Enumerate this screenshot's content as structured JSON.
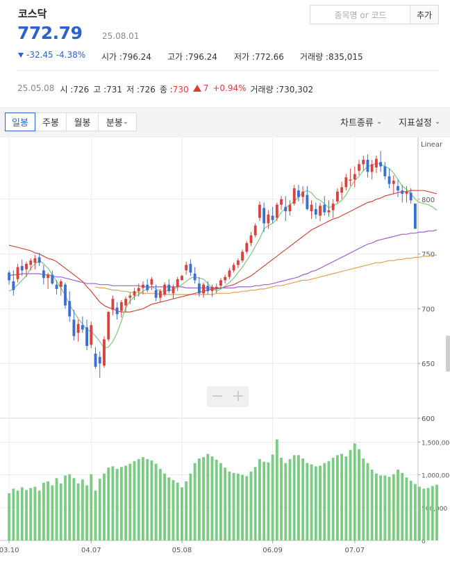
{
  "header": {
    "index_name": "코스닥",
    "search_placeholder": "종목명 or 코드",
    "add_button": "추가"
  },
  "quote": {
    "price": "772.79",
    "date": "25.08.01",
    "change": "-32.45",
    "change_pct": "-4.38%",
    "open_label": "시가 :",
    "open": "796.24",
    "high_label": "고가 :",
    "high": "796.24",
    "low_label": "저가 :",
    "low": "772.66",
    "volume_label": "거래량 :",
    "volume": "835,015"
  },
  "daily_info": {
    "date": "25.05.08",
    "open_label": "시 :",
    "open": "726",
    "high_label": "고 :",
    "high": "731",
    "low_label": "저 :",
    "low": "726",
    "close_label": "종 :",
    "close": "730",
    "change": "7",
    "change_pct": "+0.94%",
    "volume_label": "거래량 :",
    "volume": "730,302"
  },
  "toolbar": {
    "tabs": [
      "일봉",
      "주봉",
      "월봉",
      "분봉"
    ],
    "active_tab": "일봉",
    "chart_type": "차트종류",
    "indicator": "지표설정"
  },
  "colors": {
    "up": "#d9423e",
    "down": "#3b6fd0",
    "ma5": "#7ec87e",
    "ma20": "#c94b3f",
    "ma60": "#9b5fd6",
    "ma120": "#e0a050",
    "volume": "#7ccb84"
  },
  "zoom": {
    "minus": "−",
    "plus": "+"
  },
  "chart_data": {
    "type": "candlestick",
    "scale": "Linear",
    "ylim": [
      600,
      850
    ],
    "y_ticks": [
      "800",
      "750",
      "700",
      "650",
      "600"
    ],
    "volume_ylim": [
      0,
      1800000
    ],
    "volume_ticks": [
      "1,500,000",
      "1,000,000",
      "500,000",
      "0"
    ],
    "x_ticks": [
      "03.10",
      "04.07",
      "05.08",
      "06.09",
      "07.07"
    ],
    "x_tick_index": [
      0,
      19,
      40,
      61,
      80
    ],
    "candles": [
      [
        733,
        735,
        722,
        726
      ],
      [
        725,
        735,
        712,
        717
      ],
      [
        727,
        741,
        724,
        738
      ],
      [
        739,
        745,
        730,
        735
      ],
      [
        736,
        743,
        729,
        741
      ],
      [
        740,
        746,
        735,
        744
      ],
      [
        742,
        749,
        736,
        746
      ],
      [
        747,
        751,
        739,
        742
      ],
      [
        735,
        740,
        722,
        728
      ],
      [
        728,
        733,
        718,
        731
      ],
      [
        731,
        735,
        722,
        723
      ],
      [
        722,
        726,
        713,
        718
      ],
      [
        720,
        727,
        712,
        725
      ],
      [
        722,
        724,
        700,
        703
      ],
      [
        707,
        716,
        688,
        693
      ],
      [
        690,
        699,
        671,
        675
      ],
      [
        678,
        690,
        670,
        686
      ],
      [
        685,
        693,
        678,
        681
      ],
      [
        683,
        690,
        662,
        666
      ],
      [
        667,
        688,
        664,
        685
      ],
      [
        659,
        665,
        645,
        647
      ],
      [
        656,
        661,
        637,
        650
      ],
      [
        648,
        675,
        646,
        672
      ],
      [
        672,
        698,
        670,
        697
      ],
      [
        699,
        712,
        694,
        709
      ],
      [
        701,
        706,
        690,
        695
      ],
      [
        698,
        708,
        692,
        706
      ],
      [
        703,
        711,
        697,
        709
      ],
      [
        710,
        715,
        704,
        712
      ],
      [
        712,
        719,
        708,
        716
      ],
      [
        716,
        723,
        711,
        719
      ],
      [
        719,
        725,
        713,
        722
      ],
      [
        722,
        727,
        715,
        717
      ],
      [
        722,
        729,
        717,
        727
      ],
      [
        717,
        722,
        707,
        710
      ],
      [
        710,
        718,
        706,
        716
      ],
      [
        713,
        724,
        711,
        722
      ],
      [
        722,
        727,
        714,
        716
      ],
      [
        714,
        722,
        709,
        720
      ],
      [
        720,
        729,
        716,
        727
      ],
      [
        726,
        731,
        726,
        730
      ],
      [
        735,
        743,
        731,
        740
      ],
      [
        741,
        745,
        730,
        733
      ],
      [
        732,
        738,
        723,
        726
      ],
      [
        723,
        729,
        711,
        714
      ],
      [
        714,
        724,
        710,
        722
      ],
      [
        721,
        725,
        713,
        716
      ],
      [
        716,
        722,
        711,
        720
      ],
      [
        718,
        723,
        714,
        720
      ],
      [
        721,
        728,
        718,
        726
      ],
      [
        726,
        731,
        723,
        729
      ],
      [
        729,
        737,
        727,
        735
      ],
      [
        735,
        742,
        733,
        740
      ],
      [
        740,
        746,
        737,
        744
      ],
      [
        744,
        754,
        742,
        752
      ],
      [
        752,
        762,
        750,
        760
      ],
      [
        760,
        770,
        757,
        767
      ],
      [
        767,
        778,
        765,
        776
      ],
      [
        783,
        798,
        780,
        795
      ],
      [
        792,
        797,
        770,
        778
      ],
      [
        778,
        790,
        773,
        786
      ],
      [
        785,
        793,
        778,
        781
      ],
      [
        783,
        797,
        780,
        795
      ],
      [
        795,
        803,
        790,
        800
      ],
      [
        793,
        803,
        780,
        789
      ],
      [
        789,
        799,
        785,
        795
      ],
      [
        796,
        813,
        794,
        810
      ],
      [
        808,
        813,
        798,
        802
      ],
      [
        802,
        812,
        796,
        807
      ],
      [
        804,
        812,
        790,
        791
      ],
      [
        789,
        799,
        782,
        795
      ],
      [
        791,
        797,
        782,
        786
      ],
      [
        785,
        797,
        780,
        794
      ],
      [
        795,
        803,
        785,
        788
      ],
      [
        788,
        799,
        784,
        790
      ],
      [
        790,
        800,
        783,
        796
      ],
      [
        798,
        810,
        796,
        807
      ],
      [
        806,
        816,
        800,
        811
      ],
      [
        811,
        823,
        808,
        820
      ],
      [
        817,
        828,
        812,
        818
      ],
      [
        818,
        830,
        811,
        823
      ],
      [
        826,
        836,
        822,
        832
      ],
      [
        832,
        840,
        826,
        836
      ],
      [
        836,
        841,
        820,
        825
      ],
      [
        825,
        836,
        818,
        832
      ],
      [
        829,
        840,
        824,
        837
      ],
      [
        834,
        844,
        825,
        830
      ],
      [
        830,
        834,
        818,
        821
      ],
      [
        821,
        828,
        810,
        814
      ],
      [
        814,
        822,
        805,
        817
      ],
      [
        812,
        818,
        802,
        808
      ],
      [
        808,
        813,
        797,
        805
      ],
      [
        805,
        812,
        797,
        807
      ],
      [
        806,
        810,
        796,
        799
      ],
      [
        796,
        796,
        773,
        773
      ]
    ],
    "volume": [
      720000,
      790000,
      760000,
      810000,
      770000,
      800000,
      820000,
      760000,
      880000,
      900000,
      840000,
      950000,
      870000,
      990000,
      1010000,
      950000,
      870000,
      930000,
      840000,
      1010000,
      760000,
      940000,
      1020000,
      1110000,
      1130000,
      1090000,
      1120000,
      1140000,
      1170000,
      1210000,
      1240000,
      1270000,
      1240000,
      1220000,
      1170000,
      1090000,
      1020000,
      960000,
      920000,
      880000,
      810000,
      900000,
      1020000,
      1180000,
      1250000,
      1270000,
      1320000,
      1280000,
      1230000,
      1180000,
      1110000,
      1050000,
      1030000,
      1020000,
      1000000,
      980000,
      1050000,
      1120000,
      1240000,
      1200000,
      1190000,
      1310000,
      1540000,
      1260000,
      1180000,
      1240000,
      1300000,
      1300000,
      1250000,
      1180000,
      1160000,
      1130000,
      1140000,
      1180000,
      1210000,
      1260000,
      1300000,
      1320000,
      1280000,
      1380000,
      1480000,
      1390000,
      1250000,
      1180000,
      1080000,
      1020000,
      990000,
      990000,
      970000,
      1010000,
      1080000,
      1030000,
      960000,
      910000,
      860000,
      820000,
      790000,
      800000,
      830000,
      850000
    ],
    "ma5": [
      716,
      718,
      722,
      726,
      730,
      737,
      741,
      744,
      741,
      737,
      731,
      725,
      719,
      712,
      704,
      697,
      691,
      686,
      681,
      679,
      675,
      670,
      664,
      665,
      670,
      678,
      689,
      701,
      707,
      711,
      713,
      716,
      718,
      720,
      718,
      716,
      716,
      717,
      717,
      720,
      722,
      725,
      728,
      729,
      728,
      727,
      723,
      719,
      716,
      718,
      721,
      724,
      728,
      733,
      738,
      744,
      750,
      757,
      764,
      773,
      776,
      778,
      782,
      788,
      792,
      795,
      798,
      802,
      806,
      808,
      806,
      801,
      799,
      796,
      792,
      794,
      796,
      799,
      804,
      811,
      817,
      821,
      826,
      830,
      831,
      833,
      832,
      830,
      828,
      824,
      818,
      812,
      809,
      805,
      800,
      797,
      796,
      795,
      793,
      790
    ],
    "ma20": [
      758,
      757,
      756,
      755,
      754,
      753,
      751,
      750,
      748,
      746,
      745,
      743,
      740,
      737,
      734,
      731,
      728,
      725,
      720,
      716,
      711,
      706,
      703,
      701,
      700,
      698,
      697,
      697,
      697,
      698,
      699,
      700,
      702,
      704,
      705,
      706,
      707,
      708,
      709,
      710,
      711,
      712,
      713,
      714,
      715,
      716,
      717,
      718,
      718,
      719,
      720,
      721,
      722,
      724,
      726,
      728,
      730,
      733,
      736,
      739,
      742,
      745,
      748,
      751,
      754,
      757,
      760,
      763,
      766,
      769,
      772,
      774,
      776,
      778,
      780,
      782,
      783,
      785,
      787,
      789,
      791,
      793,
      795,
      797,
      798,
      800,
      801,
      803,
      804,
      805,
      806,
      807,
      807,
      808,
      808,
      808,
      808,
      807,
      806,
      805
    ],
    "ma60": [
      730,
      731,
      731,
      732,
      732,
      732,
      732,
      732,
      731,
      731,
      730,
      729,
      729,
      728,
      727,
      726,
      725,
      724,
      723,
      723,
      723,
      722,
      722,
      722,
      721,
      721,
      721,
      721,
      721,
      721,
      721,
      720,
      720,
      720,
      720,
      720,
      720,
      720,
      720,
      720,
      720,
      719,
      719,
      719,
      719,
      719,
      719,
      719,
      719,
      719,
      719,
      719,
      719,
      720,
      720,
      720,
      720,
      721,
      721,
      722,
      722,
      723,
      724,
      725,
      726,
      727,
      728,
      729,
      731,
      732,
      734,
      735,
      737,
      739,
      741,
      743,
      745,
      747,
      749,
      751,
      753,
      755,
      757,
      759,
      760,
      762,
      763,
      764,
      765,
      766,
      767,
      768,
      768,
      769,
      769,
      770,
      770,
      771,
      771,
      772
    ],
    "ma120": [
      null,
      null,
      null,
      null,
      null,
      null,
      null,
      null,
      null,
      null,
      null,
      null,
      null,
      null,
      null,
      null,
      null,
      null,
      null,
      null,
      720,
      719,
      719,
      718,
      717,
      717,
      716,
      716,
      715,
      715,
      715,
      714,
      714,
      714,
      714,
      713,
      713,
      713,
      713,
      713,
      713,
      713,
      713,
      713,
      713,
      713,
      713,
      713,
      714,
      714,
      714,
      714,
      715,
      715,
      716,
      716,
      717,
      717,
      718,
      718,
      719,
      720,
      721,
      721,
      722,
      723,
      724,
      725,
      726,
      726,
      727,
      728,
      729,
      730,
      731,
      732,
      733,
      734,
      735,
      736,
      737,
      738,
      739,
      740,
      741,
      742,
      742,
      743,
      744,
      744,
      745,
      745,
      746,
      746,
      747,
      747,
      748,
      748,
      749,
      749
    ]
  }
}
